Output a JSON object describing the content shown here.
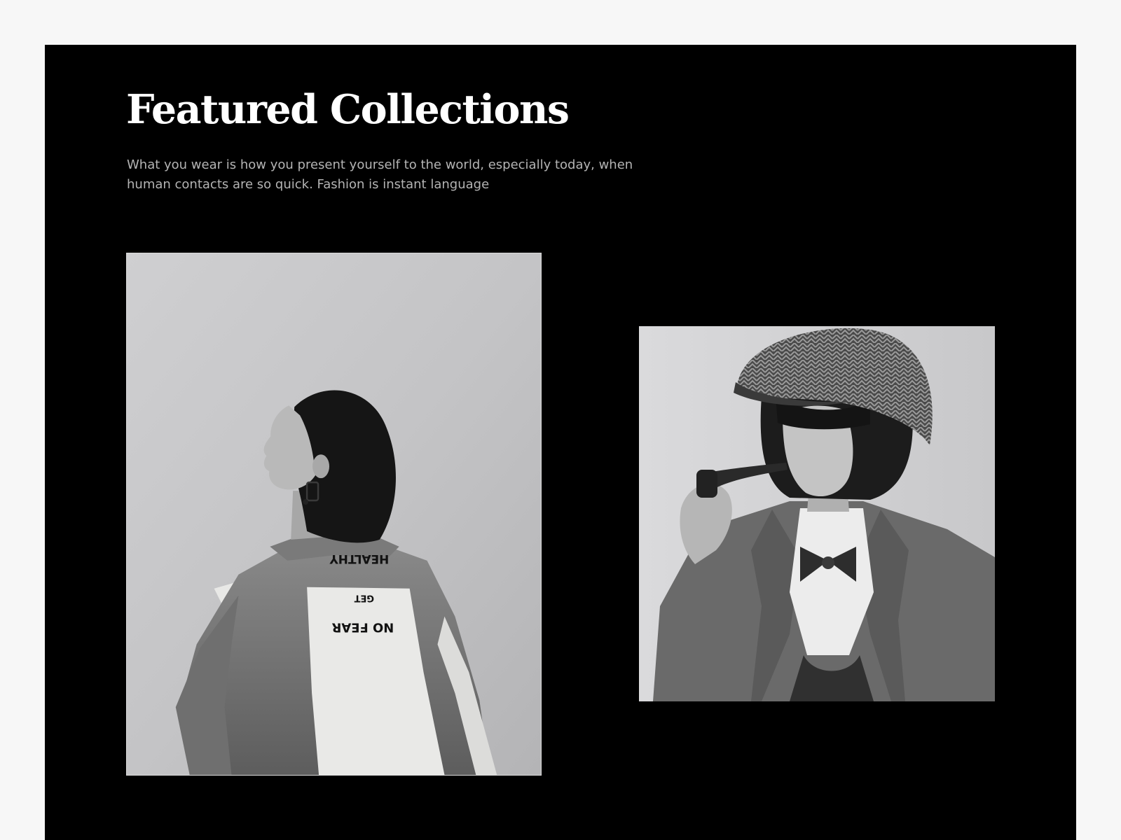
{
  "section": {
    "title": "Featured Collections",
    "subtitle_line1": "What you wear is how you present yourself to the world, especially today, when",
    "subtitle_line2": "human contacts are so quick. Fashion is instant language"
  },
  "gallery": {
    "items": [
      {
        "name": "collection-photo-denim-jacket",
        "jacket_print": [
          "HEALTHY",
          "GET",
          "NO FEAR"
        ]
      },
      {
        "name": "collection-photo-newsboy-cap"
      }
    ]
  },
  "colors": {
    "page_background": "#f7f7f7",
    "section_background": "#000000",
    "title": "#ffffff",
    "subtitle": "#b4b4b4"
  }
}
